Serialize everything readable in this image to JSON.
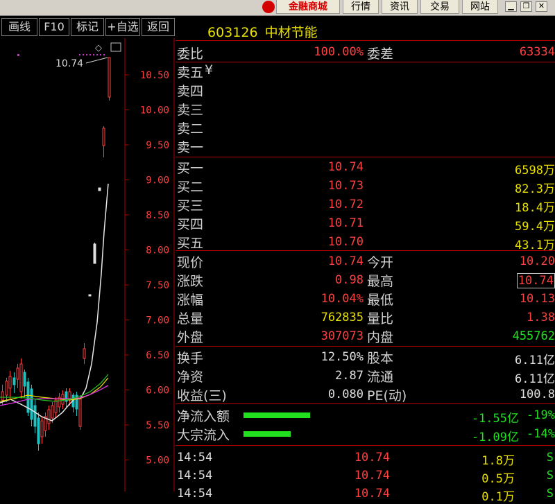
{
  "topbar": {
    "mall_label": "金融商城",
    "buttons": [
      "行情",
      "资讯",
      "交易",
      "网站"
    ]
  },
  "toolbar": {
    "buttons": [
      "画线",
      "F10",
      "标记",
      "+自选",
      "返回"
    ]
  },
  "stock": {
    "code": "603126",
    "name": "中材节能"
  },
  "chart": {
    "last_price_label": "10.74",
    "axis_ticks": [
      "10.50",
      "10.00",
      "9.50",
      "9.00",
      "8.50",
      "8.00",
      "7.50",
      "7.00",
      "6.50",
      "6.00",
      "5.50",
      "5.00"
    ]
  },
  "weibi": {
    "label": "委比",
    "value": "100.00%",
    "diff_label": "委差",
    "diff_value": "63334"
  },
  "sells": [
    {
      "label": "卖五",
      "mark": "¥"
    },
    {
      "label": "卖四"
    },
    {
      "label": "卖三"
    },
    {
      "label": "卖二"
    },
    {
      "label": "卖一"
    }
  ],
  "buys": [
    {
      "label": "买一",
      "price": "10.74",
      "volume": "6598万"
    },
    {
      "label": "买二",
      "price": "10.73",
      "volume": "82.3万"
    },
    {
      "label": "买三",
      "price": "10.72",
      "volume": "18.4万"
    },
    {
      "label": "买四",
      "price": "10.71",
      "volume": "59.4万"
    },
    {
      "label": "买五",
      "price": "10.70",
      "volume": "43.1万"
    }
  ],
  "stats": [
    {
      "l1": "现价",
      "v1": "10.74",
      "c1": "r",
      "l2": "今开",
      "v2": "10.20",
      "c2": "r"
    },
    {
      "l1": "涨跌",
      "v1": "0.98",
      "c1": "r",
      "l2": "最高",
      "v2": "10.74",
      "c2": "r"
    },
    {
      "l1": "涨幅",
      "v1": "10.04%",
      "c1": "r",
      "l2": "最低",
      "v2": "10.13",
      "c2": "r"
    },
    {
      "l1": "总量",
      "v1": "762835",
      "c1": "y",
      "l2": "量比",
      "v2": "1.38",
      "c2": "r"
    },
    {
      "l1": "外盘",
      "v1": "307073",
      "c1": "r",
      "l2": "内盘",
      "v2": "455762",
      "c2": "g"
    }
  ],
  "stats2": [
    {
      "l1": "换手",
      "v1": "12.50%",
      "l2": "股本",
      "v2": "6.11亿"
    },
    {
      "l1": "净资",
      "v1": "2.87",
      "l2": "流通",
      "v2": "6.11亿"
    },
    {
      "l1": "收益(三)",
      "v1": "0.080",
      "l2": "PE(动)",
      "v2": "100.8"
    }
  ],
  "flows": [
    {
      "label": "净流入额",
      "value": "-1.55亿",
      "pct": "-19%"
    },
    {
      "label": "大宗流入",
      "value": "-1.09亿",
      "pct": "-14%"
    }
  ],
  "ticks": [
    {
      "time": "14:54",
      "price": "10.74",
      "vol": "1.8万",
      "side": "S"
    },
    {
      "time": "14:54",
      "price": "10.74",
      "vol": "0.5万",
      "side": "S"
    },
    {
      "time": "14:54",
      "price": "10.74",
      "vol": "0.1万",
      "side": "S"
    }
  ]
}
